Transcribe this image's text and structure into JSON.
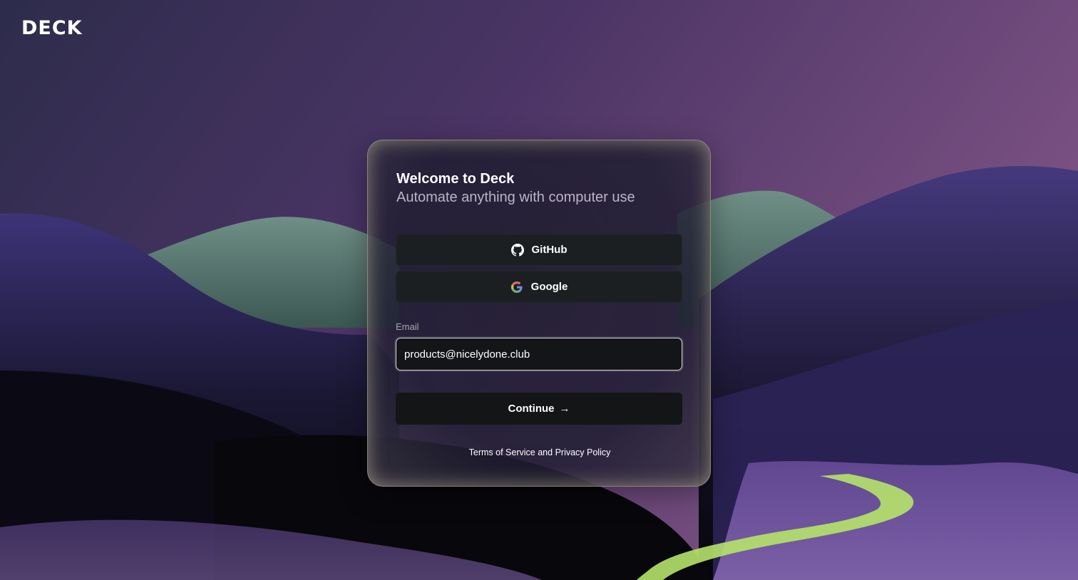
{
  "brand": {
    "logo_text": "DECK"
  },
  "card": {
    "title": "Welcome to Deck",
    "subtitle": "Automate anything with computer use"
  },
  "oauth": {
    "github": {
      "label": "GitHub",
      "icon": "github-icon"
    },
    "google": {
      "label": "Google",
      "icon": "google-icon"
    }
  },
  "email": {
    "label": "Email",
    "value": "products@nicelydone.club",
    "placeholder": ""
  },
  "continue": {
    "label": "Continue",
    "icon": "arrow-right-icon"
  },
  "legal": {
    "terms": "Terms of Service",
    "and": "and",
    "privacy": "Privacy Policy"
  },
  "colors": {
    "button_bg": "#1c1f21",
    "card_border": "#d6d2b4",
    "sky_top": "#3f2f5c",
    "sky_right": "#7a5283",
    "hills": "#2a2350",
    "stream": "#b6e36a"
  }
}
